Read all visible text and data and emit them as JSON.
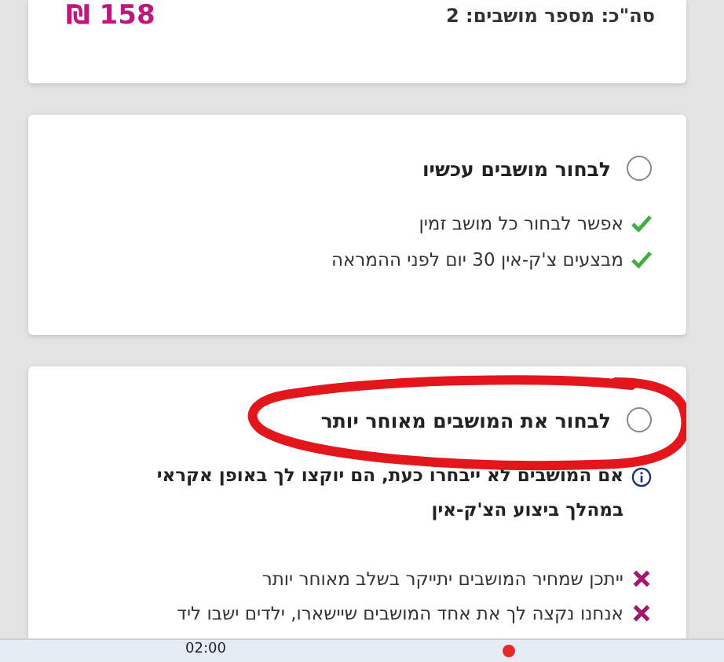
{
  "summary": {
    "label": "סה\"כ: מספר מושבים: 2",
    "price": "158 ₪"
  },
  "options": [
    {
      "label": "לבחור מושבים עכשיו",
      "selected": false,
      "circled": false,
      "points": [
        {
          "kind": "pro",
          "text": "אפשר לבחור כל מושב זמין"
        },
        {
          "kind": "pro",
          "text": "מבצעים צ'ק-אין 30 יום לפני ההמראה"
        }
      ]
    },
    {
      "label": "לבחור את המושבים מאוחר יותר",
      "selected": false,
      "circled": true,
      "note": "אם המושבים לא ייבחרו כעת, הם יוקצו לך באופן אקראי במהלך ביצוע הצ'ק-אין",
      "points": [
        {
          "kind": "con",
          "text": "ייתכן שמחיר המושבים יתייקר בשלב מאוחר יותר"
        },
        {
          "kind": "con",
          "text": "אנחנו נקצה לך את אחד המושבים שיישארו, ילדים ישבו ליד"
        }
      ]
    }
  ],
  "taskbar": {
    "time": "02:00"
  }
}
